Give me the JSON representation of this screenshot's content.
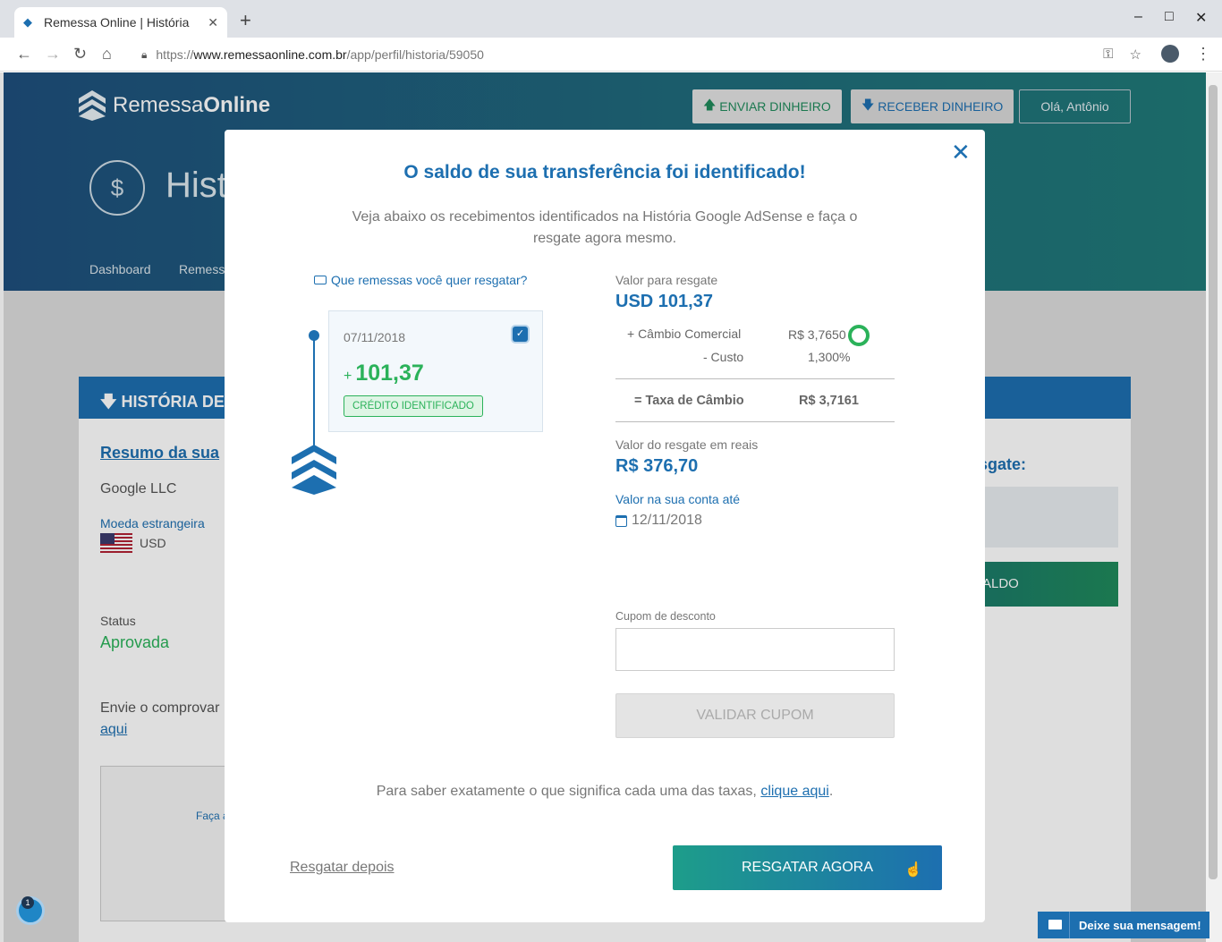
{
  "browser": {
    "tab_title": "Remessa Online | História",
    "url_scheme": "https://",
    "url_host": "www.remessaonline.com.br",
    "url_path": "/app/perfil/historia/59050"
  },
  "header": {
    "logo_light": "Remessa",
    "logo_bold": "Online",
    "send_btn": "ENVIAR DINHEIRO",
    "receive_btn": "RECEBER DINHEIRO",
    "hello_btn": "Olá, Antônio",
    "page_title": "Hist",
    "nav": [
      "Dashboard",
      "Remess"
    ]
  },
  "background": {
    "section_title": "HISTÓRIA DE",
    "summary_heading": "Resumo da sua",
    "company": "Google LLC",
    "currency_label": "Moeda estrangeira",
    "currency": "USD",
    "status_label": "Status",
    "status_value": "Aprovada",
    "send_proof": "Envie o comprovar",
    "send_proof_link": "aqui",
    "upload_text": "Faça a",
    "right_heading": "sgate:",
    "right_btn": "ALDO"
  },
  "modal": {
    "title": "O saldo de sua transferência foi identificado!",
    "subtitle": "Veja abaixo os recebimentos identificados na História Google AdSense e faça o resgate agora mesmo.",
    "question": "Que remessas você quer resgatar?",
    "receipt": {
      "date": "07/11/2018",
      "plus": "+",
      "amount": "101,37",
      "badge": "CRÉDITO IDENTIFICADO"
    },
    "redeem_label": "Valor para resgate",
    "redeem_value": "USD 101,37",
    "commercial_label": "+ Câmbio Comercial",
    "commercial_value": "R$ 3,7650",
    "cost_label": "- Custo",
    "cost_value": "1,300%",
    "rate_label": "= Taxa de Câmbio",
    "rate_value": "R$ 3,7161",
    "brl_label": "Valor do resgate em reais",
    "brl_value": "R$ 376,70",
    "account_label": "Valor na sua conta até",
    "account_date": "12/11/2018",
    "coupon_label": "Cupom de desconto",
    "coupon_placeholder": "",
    "validate_btn": "VALIDAR CUPOM",
    "fee_text": "Para saber exatamente o que significa cada uma das taxas,",
    "fee_link": "clique aqui",
    "later_link": "Resgatar depois",
    "now_btn": "RESGATAR AGORA"
  },
  "widgets": {
    "chat": "Deixe sua mensagem!",
    "notif_count": "1"
  },
  "colors": {
    "brand_blue": "#1d6fb0",
    "success_green": "#2bb25a"
  }
}
